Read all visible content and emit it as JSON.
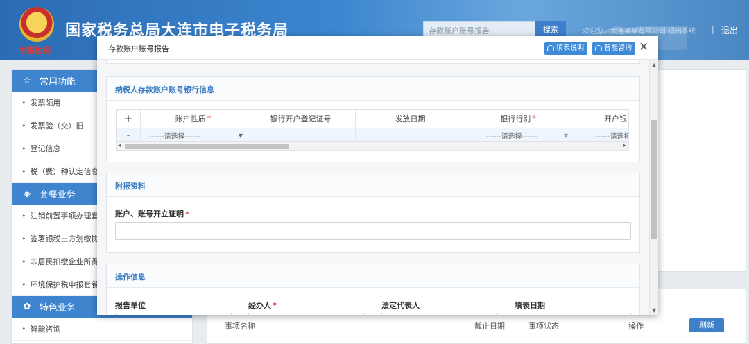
{
  "header": {
    "title": "国家税务总局大连市电子税务局",
    "emblem_caption": "中国税务",
    "search_placeholder": "存款账户账号报告",
    "search_button": "搜索",
    "user_info": "欢迎您，大连某某有限公司 退出系统",
    "separator": "|",
    "logout": "退出"
  },
  "sidebar": {
    "sections": [
      {
        "title": "常用功能",
        "icon": "star-icon",
        "items": [
          "发票领用",
          "发票验（交）旧",
          "登记信息",
          "税（费）种认定信息"
        ]
      },
      {
        "title": "套餐业务",
        "icon": "package-icon",
        "items": [
          "注销前置事项办理套餐",
          "签署银税三方划缴协议",
          "非居民扣缴企业所得税",
          "环境保护税申报套餐"
        ]
      },
      {
        "title": "特色业务",
        "icon": "feature-icon",
        "items": [
          "智能咨询"
        ]
      }
    ]
  },
  "list": {
    "col_name": "事项名称",
    "col_deadline": "截止日期",
    "col_status": "事项状态",
    "col_action": "操作",
    "refresh": "刷新"
  },
  "modal": {
    "title": "存款账户账号报告",
    "btn_fill_guide": "填表说明",
    "btn_smart_consult": "智能咨询",
    "close": "✕",
    "bank_section": {
      "title": "纳税人存款账户账号银行信息",
      "add": "+",
      "remove": "-",
      "columns": [
        "账户性质",
        "银行开户登记证号",
        "发放日期",
        "银行行别",
        "开户银"
      ],
      "required_cols": [
        true,
        false,
        false,
        true,
        false
      ],
      "row": {
        "account_type": "------请选择------",
        "bank_type": "------请选择------",
        "open_bank": "------请选择"
      }
    },
    "attach_section": {
      "title": "附报资料",
      "field_label": "账户、账号开立证明"
    },
    "ops_section": {
      "title": "操作信息",
      "fields": [
        "报告单位",
        "经办人",
        "法定代表人",
        "填表日期"
      ],
      "required": [
        false,
        true,
        false,
        false
      ]
    },
    "required_mark": "*"
  }
}
